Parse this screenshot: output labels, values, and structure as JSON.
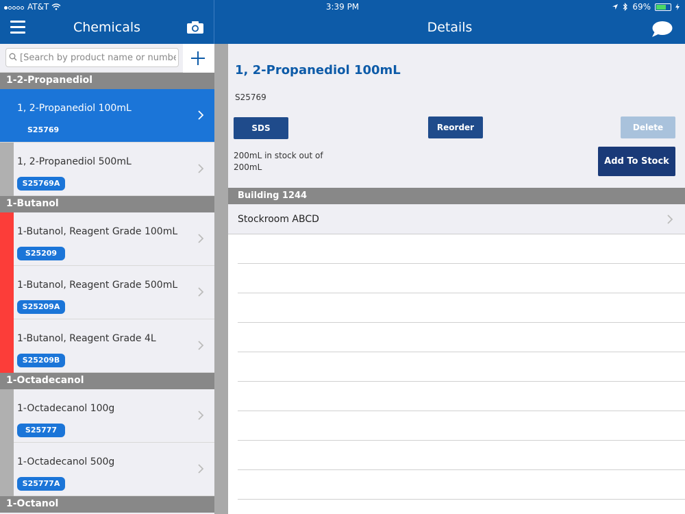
{
  "status_bar": {
    "carrier": "AT&T",
    "time": "3:39 PM",
    "battery": "69%",
    "battery_level": 0.69
  },
  "header": {
    "left_title": "Chemicals",
    "right_title": "Details",
    "menu_icon": "hamburger-icon",
    "camera_icon": "camera-icon",
    "chat_icon": "chat-bubble-icon"
  },
  "search": {
    "placeholder": "[Search by product name or number]",
    "value": ""
  },
  "groups": [
    {
      "header": "1-2-Propanediol",
      "items": [
        {
          "name": "1, 2-Propanediol 100mL",
          "code": "S25769",
          "selected": true
        },
        {
          "name": "1, 2-Propanediol 500mL",
          "code": "S25769A"
        }
      ]
    },
    {
      "header": "1-Butanol",
      "items": [
        {
          "name": "1-Butanol, Reagent Grade 100mL",
          "code": "S25209"
        },
        {
          "name": "1-Butanol, Reagent Grade 500mL",
          "code": "S25209A"
        },
        {
          "name": "1-Butanol, Reagent Grade 4L",
          "code": "S25209B"
        }
      ]
    },
    {
      "header": "1-Octadecanol",
      "items": [
        {
          "name": "1-Octadecanol 100g",
          "code": "S25777"
        },
        {
          "name": "1-Octadecanol 500g",
          "code": "S25777A"
        }
      ]
    },
    {
      "header": "1-Octanol",
      "items": []
    }
  ],
  "details": {
    "title": "1, 2-Propanediol 100mL",
    "code": "S25769",
    "sds_label": "SDS",
    "reorder_label": "Reorder",
    "delete_label": "Delete",
    "add_stock_label": "Add To Stock",
    "stock_text": "200mL in stock out of 200mL",
    "building": "Building 1244",
    "room": "Stockroom ABCD"
  },
  "colors": {
    "primary": "#0d5ba8",
    "selected": "#1b75d8",
    "hazard_flag": "#fc3d39",
    "neutral_flag": "#b0b0b0",
    "group_header": "#888888"
  }
}
